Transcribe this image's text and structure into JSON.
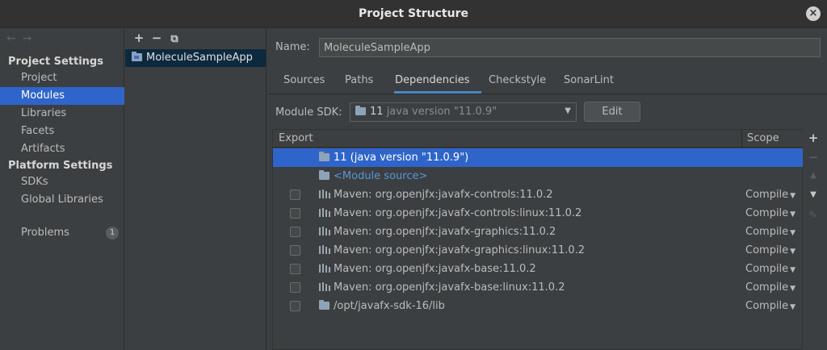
{
  "window": {
    "title": "Project Structure"
  },
  "nav": {
    "section_project": "Project Settings",
    "section_platform": "Platform Settings",
    "items": [
      {
        "label": "Project"
      },
      {
        "label": "Modules"
      },
      {
        "label": "Libraries"
      },
      {
        "label": "Facets"
      },
      {
        "label": "Artifacts"
      },
      {
        "label": "SDKs"
      },
      {
        "label": "Global Libraries"
      },
      {
        "label": "Problems"
      }
    ],
    "problems_count": "1"
  },
  "modules": {
    "add": "+",
    "remove": "−",
    "copy": "⧉",
    "items": [
      {
        "label": "MoleculeSampleApp"
      }
    ]
  },
  "form": {
    "name_label": "Name:",
    "name_value": "MoleculeSampleApp",
    "tabs": [
      {
        "label": "Sources"
      },
      {
        "label": "Paths"
      },
      {
        "label": "Dependencies"
      },
      {
        "label": "Checkstyle"
      },
      {
        "label": "SonarLint"
      }
    ],
    "sdk_label": "Module SDK:",
    "sdk_value_main": "11",
    "sdk_value_detail": "java version \"11.0.9\"",
    "edit_label": "Edit"
  },
  "table": {
    "col_export": "Export",
    "col_scope": "Scope",
    "rows": [
      {
        "text": "11 (java version \"11.0.9\")",
        "scope": ""
      },
      {
        "text": "<Module source>",
        "scope": ""
      },
      {
        "text": "Maven: org.openjfx:javafx-controls:11.0.2",
        "scope": "Compile"
      },
      {
        "text": "Maven: org.openjfx:javafx-controls:linux:11.0.2",
        "scope": "Compile"
      },
      {
        "text": "Maven: org.openjfx:javafx-graphics:11.0.2",
        "scope": "Compile"
      },
      {
        "text": "Maven: org.openjfx:javafx-graphics:linux:11.0.2",
        "scope": "Compile"
      },
      {
        "text": "Maven: org.openjfx:javafx-base:11.0.2",
        "scope": "Compile"
      },
      {
        "text": "Maven: org.openjfx:javafx-base:linux:11.0.2",
        "scope": "Compile"
      },
      {
        "text": "/opt/javafx-sdk-16/lib",
        "scope": "Compile"
      }
    ]
  },
  "side_toolbar": {
    "add": "+",
    "remove": "−",
    "up": "▲",
    "down": "▼",
    "edit": "✎"
  }
}
